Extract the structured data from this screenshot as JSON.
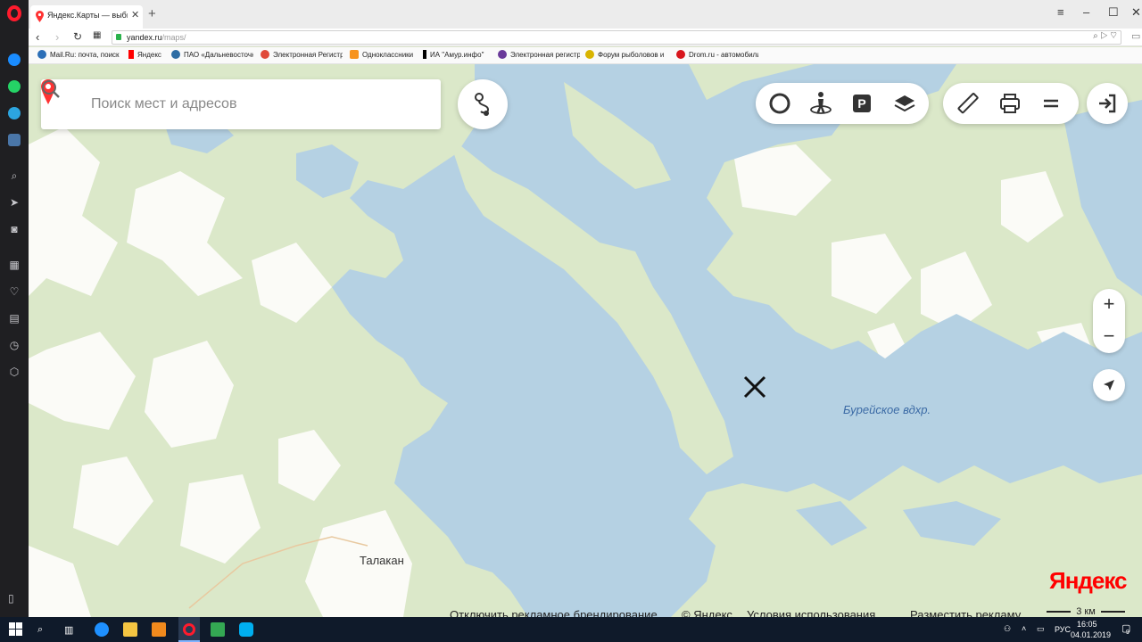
{
  "browser": {
    "tab_title": "Яндекс.Карты — выбирайте",
    "url_host": "yandex.ru",
    "url_path": "/maps/",
    "bookmarks": [
      {
        "label": "Mail.Ru: почта, поиск",
        "color": "#2c6fb7"
      },
      {
        "label": "Яндекс",
        "color": "#ff0000"
      },
      {
        "label": "ПАО «Дальневосточная",
        "color": "#2e6da4"
      },
      {
        "label": "Электронная Регистр.",
        "color": "#e04a3a"
      },
      {
        "label": "Одноклассники",
        "color": "#f7931e"
      },
      {
        "label": "ИА \"Амур.инфо\"",
        "color": "#000000"
      },
      {
        "label": "Электронная регистр.",
        "color": "#6a3a9a"
      },
      {
        "label": "Форум рыболовов и",
        "color": "#d9b400"
      },
      {
        "label": "Drom.ru - автомобили",
        "color": "#d8161d"
      }
    ]
  },
  "search": {
    "placeholder": "Поиск мест и адресов"
  },
  "map": {
    "labels": {
      "settlement": "Талакан",
      "reservoir": "Бурейское вдхр."
    },
    "logo": "Яндекс",
    "scale": "3 км",
    "footer": {
      "disable_branding": "Отключить рекламное брендирование",
      "copyright": "© Яндекс",
      "terms": "Условия использования",
      "ads": "Разместить рекламу"
    },
    "colors": {
      "water": "#b5d1e3",
      "forest": "#dbe8c9",
      "open_land": "#fbfbf7",
      "brand": "#ff0000"
    }
  },
  "taskbar": {
    "lang": "РУС",
    "time": "16:05",
    "date": "04.01.2019",
    "notifications": "9"
  }
}
